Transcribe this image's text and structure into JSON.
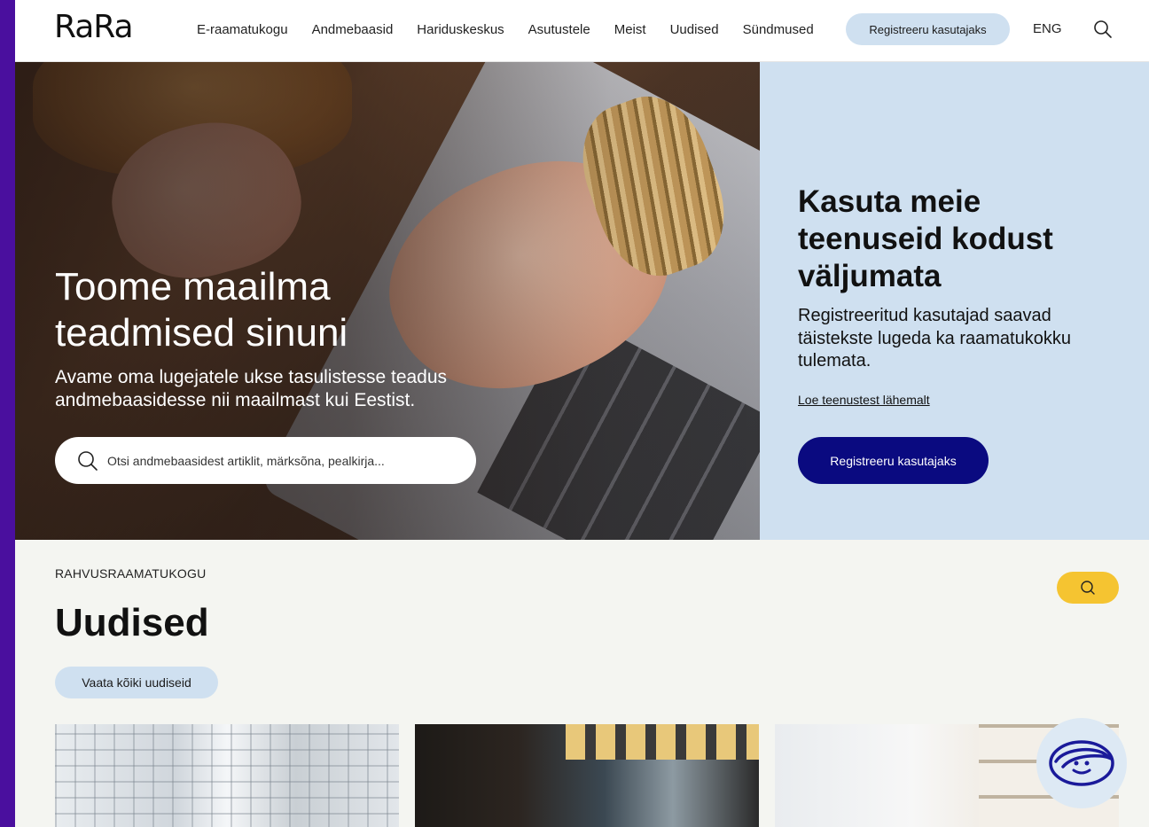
{
  "header": {
    "logo": "RaRa",
    "nav": [
      "E-raamatukogu",
      "Andmebaasid",
      "Hariduskeskus",
      "Asutustele",
      "Meist",
      "Uudised",
      "Sündmused"
    ],
    "register_label": "Registreeru kasutajaks",
    "lang_label": "ENG"
  },
  "hero": {
    "title_line1": "Toome maailma",
    "title_line2": "teadmised sinuni",
    "subtitle": "Avame oma lugejatele ukse tasulistesse teadus andmebaasidesse nii maailmast kui Eestist.",
    "search_placeholder": "Otsi andmebaasidest artiklit, märksõna, pealkirja..."
  },
  "promo": {
    "title": "Kasuta meie teenuseid kodust väljumata",
    "subtitle": "Registreeritud kasutajad saavad täistekste lugeda ka raamatukokku tulemata.",
    "link_label": "Loe teenustest lähemalt",
    "button_label": "Registreeru kasutajaks"
  },
  "news": {
    "eyebrow": "RAHVUSRAAMATUKOGU",
    "title": "Uudised",
    "all_label": "Vaata kõiki uudiseid"
  },
  "colors": {
    "accent_dark": "#0a0a80",
    "pill_blue": "#cfe0f0",
    "yellow": "#f5c431",
    "frame": "#4a0f9e"
  },
  "icons": [
    "search-icon",
    "chat-bot-icon"
  ]
}
